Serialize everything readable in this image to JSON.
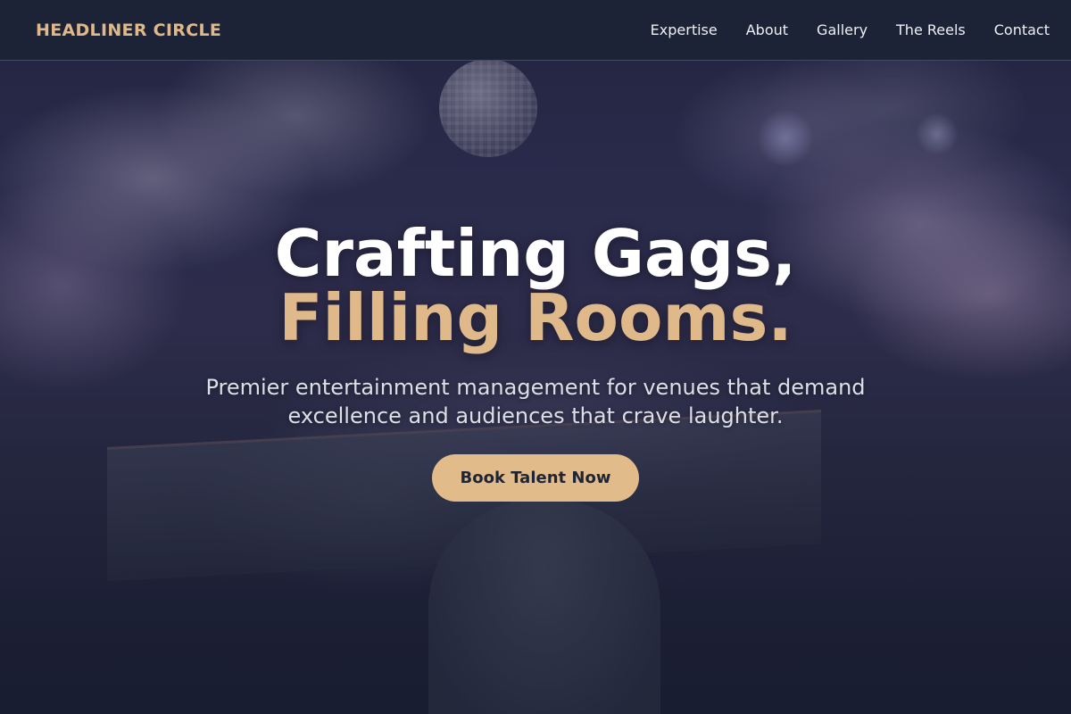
{
  "nav": {
    "brand": "HEADLINER CIRCLE",
    "links": [
      "Expertise",
      "About",
      "Gallery",
      "The Reels",
      "Contact"
    ]
  },
  "hero": {
    "headline_line1": "Crafting Gags,",
    "headline_line2": "Filling Rooms.",
    "subtext": "Premier entertainment management for venues that demand excellence and audiences that crave laughter.",
    "cta_label": "Book Talent Now"
  },
  "colors": {
    "accent": "#e0b98a",
    "navbar_bg": "#1c2336",
    "headline_primary": "#ffffff",
    "cta_text": "#1f2535"
  }
}
